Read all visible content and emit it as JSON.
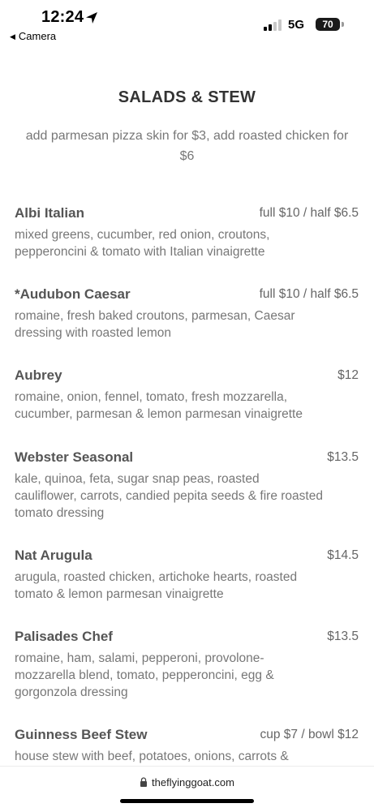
{
  "status_bar": {
    "time": "12:24",
    "back_label": "Camera",
    "network": "5G",
    "battery": "70"
  },
  "section": {
    "title": "SALADS & STEW",
    "note": "add parmesan pizza skin for $3, add roasted chicken for $6"
  },
  "items": [
    {
      "name": "Albi Italian",
      "price": "full $10 / half $6.5",
      "desc": "mixed greens, cucumber, red onion, croutons, pepperoncini & tomato with Italian vinaigrette"
    },
    {
      "name": "*Audubon Caesar",
      "price": "full $10 / half $6.5",
      "desc": "romaine, fresh baked croutons, parmesan, Caesar dressing with roasted lemon"
    },
    {
      "name": "Aubrey",
      "price": "$12",
      "desc": "romaine, onion, fennel, tomato, fresh mozzarella, cucumber, parmesan & lemon parmesan vinaigrette"
    },
    {
      "name": "Webster Seasonal",
      "price": "$13.5",
      "desc": "kale, quinoa, feta, sugar snap peas, roasted cauliflower, carrots, candied pepita seeds & fire roasted tomato dressing"
    },
    {
      "name": "Nat Arugula",
      "price": "$14.5",
      "desc": "arugula, roasted chicken, artichoke hearts, roasted tomato & lemon parmesan vinaigrette"
    },
    {
      "name": "Palisades Chef",
      "price": "$13.5",
      "desc": "romaine, ham, salami, pepperoni, provolone-mozzarella blend, tomato, pepperoncini, egg & gorgonzola dressing"
    },
    {
      "name": "Guinness Beef Stew",
      "price": "cup $7 / bowl $12",
      "desc": "house stew with beef, potatoes, onions, carrots &"
    }
  ],
  "browser": {
    "url": "theflyinggoat.com"
  }
}
